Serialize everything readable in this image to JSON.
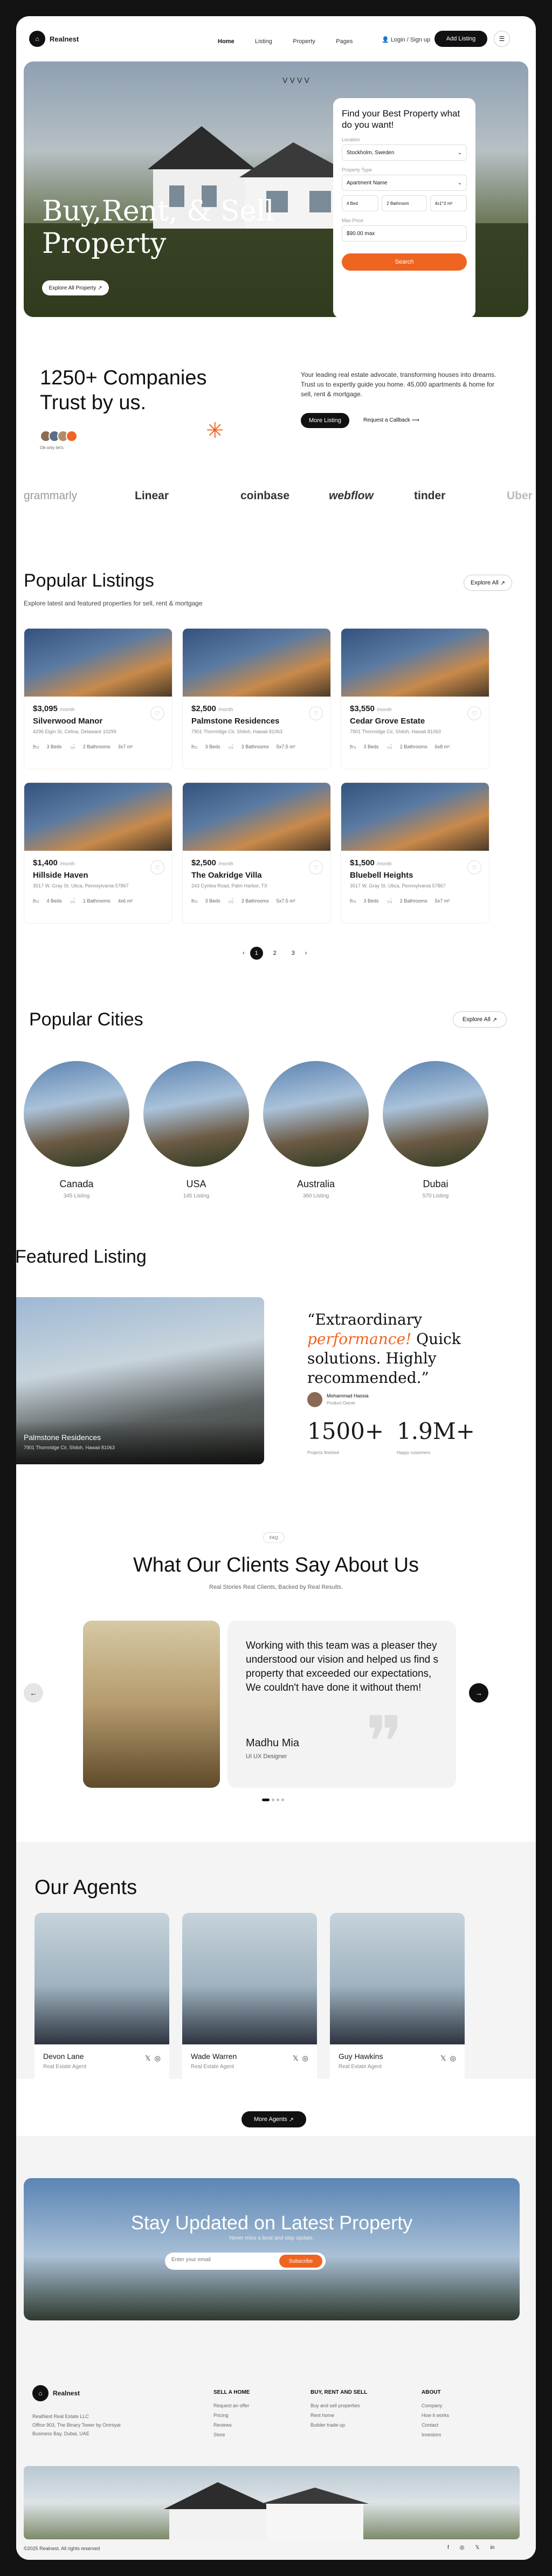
{
  "brand": {
    "name": "Realnest"
  },
  "nav": {
    "links": [
      "Home",
      "Listing",
      "Property",
      "Pages"
    ],
    "login": "Login / Sign up",
    "add": "Add Listing"
  },
  "hero": {
    "title_line1": "Buy,Rent, & Sell",
    "title_line2": "Property",
    "explore": "Explore All Property"
  },
  "search": {
    "title": "Find your Best Property what do you want!",
    "location_label": "Location",
    "location_value": "Stockholm, Sweden",
    "type_label": "Property Type",
    "type_value": "Apartment Name",
    "beds": "4 Bed",
    "baths": "2 Bathroom",
    "area": "4x1^2 m²",
    "price_label": "Max Price",
    "price_value": "$90.00 max",
    "button": "Search"
  },
  "stats": {
    "title_line1": "1250+ Companies",
    "title_line2": "Trust by us.",
    "avatars_label": "Ok-only let's",
    "desc": "Your leading real estate advocate, transforming houses into dreams. Trust us to expertly guide you home. 45,000 apartments & home for sell, rent & mortgage.",
    "more": "More Listing",
    "callback": "Request a Callback"
  },
  "logos": [
    "grammarly",
    "Linear",
    "coinbase",
    "webflow",
    "tinder",
    "Uber"
  ],
  "popular": {
    "title": "Popular Listings",
    "subtitle": "Explore latest and featured properties for sell, rent & mortgage",
    "explore": "Explore All",
    "cards": [
      {
        "price": "$3,095",
        "per": "/month",
        "name": "Silverwood Manor",
        "addr": "4296 Elgin St, Celina, Delaware 10299",
        "beds": "3 Beds",
        "baths": "2 Bathrooms",
        "area": "3x7 m²"
      },
      {
        "price": "$2,500",
        "per": "/month",
        "name": "Palmstone Residences",
        "addr": "7901 Thornridge Cir, Shiloh, Hawaii 81063",
        "beds": "3 Beds",
        "baths": "3 Bathrooms",
        "area": "5x7.5 m²"
      },
      {
        "price": "$3,550",
        "per": "/month",
        "name": "Cedar Grove Estate",
        "addr": "7901 Thornridge Cir, Shiloh, Hawaii 81063",
        "beds": "3 Beds",
        "baths": "2 Bathrooms",
        "area": "6x8 m²"
      },
      {
        "price": "$1,400",
        "per": "/month",
        "name": "Hillside Haven",
        "addr": "3517 W. Gray St. Utica, Pennsylvania 57867",
        "beds": "4 Beds",
        "baths": "1 Bathrooms",
        "area": "4x6 m²"
      },
      {
        "price": "$2,500",
        "per": "/month",
        "name": "The Oakridge Villa",
        "addr": "243 Cyrilea Road, Palm Harbor, TX",
        "beds": "3 Beds",
        "baths": "3 Bathrooms",
        "area": "5x7.5 m²"
      },
      {
        "price": "$1,500",
        "per": "/month",
        "name": "Bluebell Heights",
        "addr": "3517 W. Gray St. Utica, Pennsylvania 57867",
        "beds": "3 Beds",
        "baths": "2 Bathrooms",
        "area": "5x7 m²"
      }
    ],
    "pages": [
      "1",
      "2",
      "3"
    ]
  },
  "cities": {
    "title": "Popular Cities",
    "explore": "Explore All",
    "list": [
      {
        "name": "Canada",
        "count": "345 Listing"
      },
      {
        "name": "USA",
        "count": "145 Listing"
      },
      {
        "name": "Australia",
        "count": "360 Listing"
      },
      {
        "name": "Dubai",
        "count": "570 Listing"
      }
    ]
  },
  "featured": {
    "title": "Featured Listing",
    "card_name": "Palmstone Residences",
    "card_addr": "7901 Thornridge Cir, Shiloh, Hawaii 81063",
    "quote_pre": "“Extraordinary",
    "quote_em": "performance!",
    "quote_rest": "Quick solutions. Highly recommended.”",
    "person_name": "Mohammad Hassia",
    "person_role": "Product Owner",
    "stat1": "1500+",
    "stat1_label": "Projects finished",
    "stat2": "1.9M+",
    "stat2_label": "Happy customers"
  },
  "testimonial": {
    "badge": "FAQ",
    "title": "What Our Clients Say About Us",
    "subtitle": "Real Stories Real Clients, Backed by Real Results.",
    "quote": "Working with this team was a pleaser they understood our vision and helped us find s property that exceeded our expectations, We couldn't have done it without them!",
    "name": "Madhu Mia",
    "role": "UI UX Designer"
  },
  "agents": {
    "title": "Our Agents",
    "list": [
      {
        "name": "Devon Lane",
        "role": "Real Estate Agent"
      },
      {
        "name": "Wade Warren",
        "role": "Real Estate Agent"
      },
      {
        "name": "Guy Hawkins",
        "role": "Real Estate Agent"
      }
    ],
    "more": "More Agents"
  },
  "newsletter": {
    "title": "Stay Updated on Latest Property",
    "sub": "Never miss a beat and stay update.",
    "placeholder": "Enter your email",
    "button": "Subscribe"
  },
  "footer": {
    "addr1": "RealNest Real Estate LLC",
    "addr2": "Office 903, The Binary Tower by Omniyat",
    "addr3": "Business Bay, Dubai, UAE",
    "col1": {
      "title": "SELL A HOME",
      "items": [
        "Request an offer",
        "Pricing",
        "Reviews",
        "Store"
      ]
    },
    "col2": {
      "title": "BUY, RENT AND SELL",
      "items": [
        "Buy and sell properties",
        "Rent home",
        "Builder trade-up"
      ]
    },
    "col3": {
      "title": "ABOUT",
      "items": [
        "Company",
        "How it works",
        "Contact",
        "Investors"
      ]
    },
    "copyright": "©2025 Realnest. All rights reserved"
  }
}
